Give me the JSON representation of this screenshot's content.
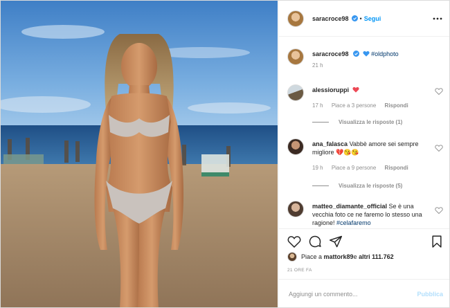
{
  "post": {
    "author": "saracroce98",
    "follow_label": "Segui",
    "separator": "•",
    "more_icon": "more-horizontal-icon",
    "caption_author": "saracroce98",
    "caption_text": "#oldphoto",
    "caption_time": "21 h"
  },
  "comments": [
    {
      "user": "alessioruppi",
      "text": "",
      "time": "17 h",
      "likes": "Piace a 3 persone",
      "reply": "Rispondi",
      "replies": "Visualizza le risposte (1)"
    },
    {
      "user": "ana_falasca",
      "text": "Vabbè amore sei sempre migliore 💔😘😘",
      "time": "19 h",
      "likes": "Piace a 9 persone",
      "reply": "Rispondi",
      "replies": "Visualizza le risposte (5)"
    },
    {
      "user": "matteo_diamante_official",
      "text": "Se è una vecchia foto ce ne faremo lo stesso una ragione!",
      "hashtag": "#celafaremo"
    }
  ],
  "footer": {
    "likes_prefix": "Piace a ",
    "likes_user": "mattork89",
    "likes_middle": " e ",
    "likes_others": "altri 111.762",
    "timestamp": "21 ORE FA",
    "comment_placeholder": "Aggiungi un commento...",
    "publish_label": "Pubblica"
  },
  "colors": {
    "accent": "#0095f6",
    "heart_red": "#ed4956",
    "verified_blue": "#3897f0",
    "publish_disabled": "#b2dffc"
  }
}
